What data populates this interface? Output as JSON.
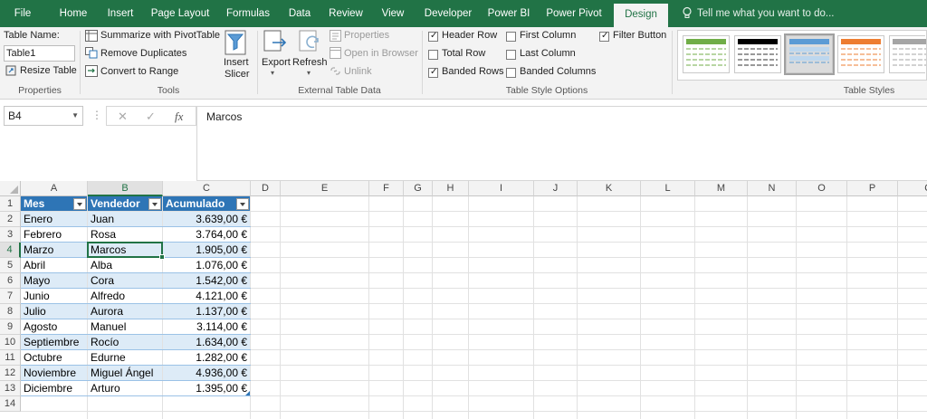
{
  "ribbon_tabs": [
    "File",
    "Home",
    "Insert",
    "Page Layout",
    "Formulas",
    "Data",
    "Review",
    "View",
    "Developer",
    "Power BI",
    "Power Pivot",
    "Design"
  ],
  "active_tab": "Design",
  "tell_me": "Tell me what you want to do...",
  "properties": {
    "table_name_label": "Table Name:",
    "table_name_value": "Table1",
    "resize_table": "Resize Table",
    "group_label": "Properties"
  },
  "tools": {
    "summarize": "Summarize with PivotTable",
    "remove_duplicates": "Remove Duplicates",
    "convert_to_range": "Convert to Range",
    "insert_slicer_line1": "Insert",
    "insert_slicer_line2": "Slicer",
    "group_label": "Tools"
  },
  "external": {
    "export": "Export",
    "refresh": "Refresh",
    "properties": "Properties",
    "open_in_browser": "Open in Browser",
    "unlink": "Unlink",
    "group_label": "External Table Data"
  },
  "style_options": {
    "header_row": "Header Row",
    "total_row": "Total Row",
    "banded_rows": "Banded Rows",
    "first_column": "First Column",
    "last_column": "Last Column",
    "banded_columns": "Banded Columns",
    "filter_button": "Filter Button",
    "header_row_checked": true,
    "total_row_checked": false,
    "banded_rows_checked": true,
    "first_column_checked": false,
    "last_column_checked": false,
    "banded_columns_checked": false,
    "filter_button_checked": true,
    "group_label": "Table Style Options"
  },
  "table_styles": {
    "group_label": "Table Styles",
    "swatch_colors": [
      "#70ad47",
      "#000000",
      "#5b9bd5",
      "#ed7d31",
      "#a5a5a5"
    ]
  },
  "formula_bar": {
    "name_box": "B4",
    "cancel_glyph": "✕",
    "enter_glyph": "✓",
    "fx": "fx",
    "content": "Marcos"
  },
  "sheet": {
    "columns": [
      "A",
      "B",
      "C",
      "D",
      "E",
      "F",
      "G",
      "H",
      "I",
      "J",
      "K",
      "L",
      "M",
      "N",
      "O",
      "P",
      "Q"
    ],
    "rows": [
      "1",
      "2",
      "3",
      "4",
      "5",
      "6",
      "7",
      "8",
      "9",
      "10",
      "11",
      "12",
      "13",
      "14"
    ],
    "selected_cell": "B4",
    "headers": [
      "Mes",
      "Vendedor",
      "Acumulado"
    ],
    "data": [
      [
        "Enero",
        "Juan",
        "3.639,00 €"
      ],
      [
        "Febrero",
        "Rosa",
        "3.764,00 €"
      ],
      [
        "Marzo",
        "Marcos",
        "1.905,00 €"
      ],
      [
        "Abril",
        "Alba",
        "1.076,00 €"
      ],
      [
        "Mayo",
        "Cora",
        "1.542,00 €"
      ],
      [
        "Junio",
        "Alfredo",
        "4.121,00 €"
      ],
      [
        "Julio",
        "Aurora",
        "1.137,00 €"
      ],
      [
        "Agosto",
        "Manuel",
        "3.114,00 €"
      ],
      [
        "Septiembre",
        "Rocío",
        "1.634,00 €"
      ],
      [
        "Octubre",
        "Edurne",
        "1.282,00 €"
      ],
      [
        "Noviembre",
        "Miguel Ángel",
        "4.936,00 €"
      ],
      [
        "Diciembre",
        "Arturo",
        "1.395,00 €"
      ]
    ]
  },
  "colors": {
    "excel_green": "#217346",
    "table_header": "#2e75b6",
    "table_band": "#ddebf7"
  }
}
